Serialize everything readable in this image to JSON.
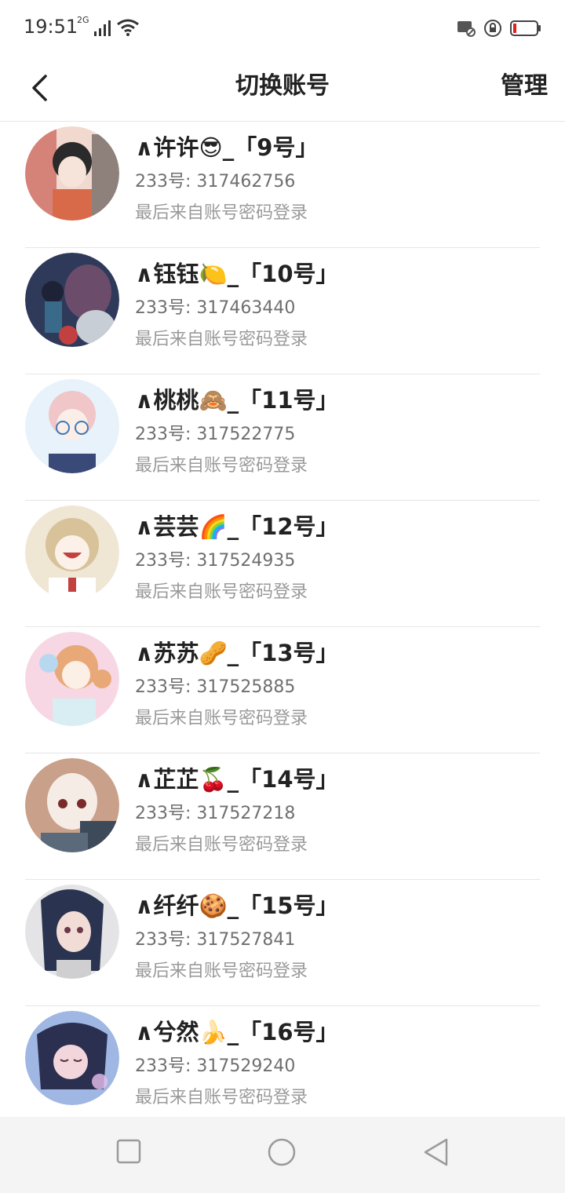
{
  "status_bar": {
    "time": "19:51",
    "network": "2G"
  },
  "header": {
    "title": "切换账号",
    "manage_label": "管理"
  },
  "accounts": [
    {
      "name": "∧许许😎_「9号」",
      "uid": "233号: 317462756",
      "login_source": "最后来自账号密码登录",
      "avatar_colors": [
        "#f2d9cf",
        "#c24a40",
        "#2a2a2a"
      ]
    },
    {
      "name": "∧钰钰🍋_「10号」",
      "uid": "233号: 317463440",
      "login_source": "最后来自账号密码登录",
      "avatar_colors": [
        "#2f3a5a",
        "#6b4c6a",
        "#c8ced6"
      ]
    },
    {
      "name": "∧桃桃🙈_「11号」",
      "uid": "233号: 317522775",
      "login_source": "最后来自账号密码登录",
      "avatar_colors": [
        "#e8f2fa",
        "#f0c6c8",
        "#3a4a78"
      ]
    },
    {
      "name": "∧芸芸🌈_「12号」",
      "uid": "233号: 317524935",
      "login_source": "最后来自账号密码登录",
      "avatar_colors": [
        "#efe6d4",
        "#d8c29a",
        "#ffffff"
      ]
    },
    {
      "name": "∧苏苏🥜_「13号」",
      "uid": "233号: 317525885",
      "login_source": "最后来自账号密码登录",
      "avatar_colors": [
        "#f7d7e3",
        "#e9a878",
        "#d8eef2"
      ]
    },
    {
      "name": "∧芷芷🍒_「14号」",
      "uid": "233号: 317527218",
      "login_source": "最后来自账号密码登录",
      "avatar_colors": [
        "#c9a08a",
        "#f6ece6",
        "#3d4a5a"
      ]
    },
    {
      "name": "∧纤纤🍪_「15号」",
      "uid": "233号: 317527841",
      "login_source": "最后来自账号密码登录",
      "avatar_colors": [
        "#e4e4e6",
        "#2a3450",
        "#f2dcd6"
      ]
    },
    {
      "name": "∧兮然🍌_「16号」",
      "uid": "233号: 317529240",
      "login_source": "最后来自账号密码登录",
      "avatar_colors": [
        "#9fb7e2",
        "#2c3050",
        "#f2d6dc"
      ]
    }
  ],
  "colors": {
    "divider": "#e6e6e6",
    "title": "#222222",
    "secondary": "#6f6f6f",
    "tertiary": "#9a9a9a",
    "battery_low": "#e02020"
  }
}
